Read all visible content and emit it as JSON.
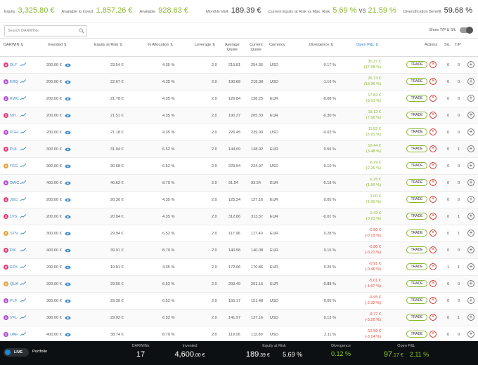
{
  "topbar": {
    "equity_label": "Equity",
    "equity_value": "3,325.80 €",
    "available_invest_label": "Available to invest",
    "available_invest_value": "1,857.26 €",
    "available_label": "Available",
    "available_value": "928.63 €",
    "monthly_var_label": "Monthly VaR",
    "monthly_var_value": "189.39 €",
    "equity_risk_label": "Current Equity at Risk vs Max. Risk",
    "equity_risk_current": "5.69 %",
    "equity_risk_sep": "vs",
    "equity_risk_max": "21.59 %",
    "diversification_label": "Diversification Benefit",
    "diversification_value": "59.68 %"
  },
  "search": {
    "placeholder": "Search DARWINs"
  },
  "toggle": {
    "label": "Show T/P & S/L"
  },
  "headers": {
    "darwin": "DARWIN",
    "invested": "Invested",
    "equity_risk": "Equity at Risk",
    "allocation": "% Allocation",
    "leverage": "Leverage",
    "avg_quote_1": "Average",
    "avg_quote_2": "Quote",
    "cur_quote_1": "Current",
    "cur_quote_2": "Quote",
    "currency": "Currency",
    "divergence": "Divergence",
    "open_pnl": "Open P&L",
    "actions": "Actions",
    "sl": "S/L",
    "tp": "T/P",
    "sort_arrow": "⇅"
  },
  "row_labels": {
    "trade": "TRADE",
    "close": "×",
    "add": "+"
  },
  "rows": [
    {
      "id": "DLF",
      "color": "#e0407a",
      "invested": "200.00 €",
      "risk": "23.54 €",
      "alloc": "4.35 %",
      "lev": "2.0",
      "avg": "215.81",
      "cur": "254.36",
      "ccy": "USD",
      "div": "-0.17 %",
      "pnl": "35.37 €",
      "pnlp": "(17.68 %)",
      "pos": true,
      "sl": "0",
      "tp": "0"
    },
    {
      "id": "ERQ",
      "color": "#b04fd0",
      "invested": "200.00 €",
      "risk": "22.67 €",
      "alloc": "4.35 %",
      "lev": "2.0",
      "avg": "190.68",
      "cur": "218.38",
      "ccy": "USD",
      "div": "-1.16 %",
      "pnl": "26.73 €",
      "pnlp": "(13.36 %)",
      "pos": true,
      "sl": "0",
      "tp": "0"
    },
    {
      "id": "KWC",
      "color": "#b04fd0",
      "invested": "200.00 €",
      "risk": "21.78 €",
      "alloc": "4.35 %",
      "lev": "2.0",
      "avg": "126.84",
      "cur": "138.25",
      "ccy": "EUR",
      "div": "-0.08 %",
      "pnl": "17.82 €",
      "pnlp": "(8.91 %)",
      "pos": true,
      "sl": "0",
      "tp": "0"
    },
    {
      "id": "NTI",
      "color": "#e0407a",
      "invested": "200.00 €",
      "risk": "21.51 €",
      "alloc": "4.35 %",
      "lev": "2.0",
      "avg": "190.37",
      "cur": "205.33",
      "ccy": "EUR",
      "div": "-0.30 %",
      "pnl": "15.12 €",
      "pnlp": "(7.56 %)",
      "pos": true,
      "sl": "0",
      "tp": "0"
    },
    {
      "id": "PGH",
      "color": "#b04fd0",
      "invested": "200.00 €",
      "risk": "21.18 €",
      "alloc": "4.35 %",
      "lev": "2.0",
      "avg": "226.45",
      "cur": "239.90",
      "ccy": "USD",
      "div": "-0.03 %",
      "pnl": "11.82 €",
      "pnlp": "(5.91 %)",
      "pos": true,
      "sl": "0",
      "tp": "0"
    },
    {
      "id": "PUL",
      "color": "#e0407a",
      "invested": "300.00 €",
      "risk": "31.04 €",
      "alloc": "6.52 %",
      "lev": "2.0",
      "avg": "144.69",
      "cur": "148.92",
      "ccy": "EUR",
      "div": "0.56 %",
      "pnl": "10.44 €",
      "pnlp": "(3.48 %)",
      "pos": true,
      "sl": "0",
      "tp": "1"
    },
    {
      "id": "FEG",
      "color": "#e8a43a",
      "invested": "300.00 €",
      "risk": "30.68 €",
      "alloc": "6.52 %",
      "lev": "2.0",
      "avg": "229.54",
      "cur": "234.97",
      "ccy": "USD",
      "div": "-0.10 %",
      "pnl": "6.79 €",
      "pnlp": "(2.26 %)",
      "pos": true,
      "sl": "0",
      "tp": "0"
    },
    {
      "id": "DWC",
      "color": "#b04fd0",
      "invested": "400.00 €",
      "risk": "40.62 €",
      "alloc": "8.70 %",
      "lev": "2.0",
      "avg": "91.94",
      "cur": "93.54",
      "ccy": "EUR",
      "div": "-0.18 %",
      "pnl": "6.25 €",
      "pnlp": "(1.56 %)",
      "pos": true,
      "sl": "0",
      "tp": "0"
    },
    {
      "id": "JGC",
      "color": "#e0407a",
      "invested": "200.00 €",
      "risk": "20.30 €",
      "alloc": "4.35 %",
      "lev": "2.0",
      "avg": "125.34",
      "cur": "127.16",
      "ccy": "EUR",
      "div": "0.05 %",
      "pnl": "3.00 €",
      "pnlp": "(1.50 %)",
      "pos": true,
      "sl": "0",
      "tp": "0"
    },
    {
      "id": "LVS",
      "color": "#e0407a",
      "invested": "200.00 €",
      "risk": "20.04 €",
      "alloc": "4.35 %",
      "lev": "2.0",
      "avg": "312.86",
      "cur": "313.57",
      "ccy": "EUR",
      "div": "-0.01 %",
      "pnl": "0.43 €",
      "pnlp": "(0.21 %)",
      "pos": true,
      "sl": "0",
      "tp": "1"
    },
    {
      "id": "STN",
      "color": "#e8a43a",
      "invested": "300.00 €",
      "risk": "29.94 €",
      "alloc": "6.52 %",
      "lev": "2.0",
      "avg": "117.96",
      "cur": "117.40",
      "ccy": "EUR",
      "div": "0.28 %",
      "pnl": "-0.56 €",
      "pnlp": "(-0.19 %)",
      "pos": false,
      "sl": "0",
      "tp": "1"
    },
    {
      "id": "PIK",
      "color": "#e0407a",
      "invested": "400.00 €",
      "risk": "39.91 €",
      "alloc": "8.70 %",
      "lev": "2.0",
      "avg": "140.58",
      "cur": "140.08",
      "ccy": "EUR",
      "div": "0.15 %",
      "pnl": "-0.86 €",
      "pnlp": "(-0.21 %)",
      "pos": false,
      "sl": "0",
      "tp": "0"
    },
    {
      "id": "EZX",
      "color": "#e0407a",
      "invested": "200.00 €",
      "risk": "19.91 €",
      "alloc": "4.35 %",
      "lev": "2.0",
      "avg": "172.06",
      "cur": "170.86",
      "ccy": "EUR",
      "div": "0.25 %",
      "pnl": "-0.91 €",
      "pnlp": "(-0.46 %)",
      "pos": false,
      "sl": "1",
      "tp": "1"
    },
    {
      "id": "QUA",
      "color": "#e8a43a",
      "invested": "300.00 €",
      "risk": "29.50 €",
      "alloc": "6.52 %",
      "lev": "2.0",
      "avg": "293.49",
      "cur": "291.16",
      "ccy": "EUR",
      "div": "-0.88 %",
      "pnl": "-5.01 €",
      "pnlp": "(-1.67 %)",
      "pos": false,
      "sl": "0",
      "tp": "0"
    },
    {
      "id": "PLF",
      "color": "#b04fd0",
      "invested": "300.00 €",
      "risk": "29.30 €",
      "alloc": "6.52 %",
      "lev": "2.0",
      "avg": "155.17",
      "cur": "151.48",
      "ccy": "USD",
      "div": "0.05 %",
      "pnl": "-6.95 €",
      "pnlp": "(-2.32 %)",
      "pos": false,
      "sl": "0",
      "tp": "0"
    },
    {
      "id": "VFL",
      "color": "#b04fd0",
      "invested": "300.00 €",
      "risk": "29.02 €",
      "alloc": "6.52 %",
      "lev": "2.0",
      "avg": "141.97",
      "cur": "137.16",
      "ccy": "USD",
      "div": "0.13 %",
      "pnl": "-9.77 €",
      "pnlp": "(-3.26 %)",
      "pos": false,
      "sl": "0",
      "tp": "1"
    },
    {
      "id": "UAF",
      "color": "#b04fd0",
      "invested": "400.00 €",
      "risk": "38.74 €",
      "alloc": "8.70 %",
      "lev": "2.0",
      "avg": "119.06",
      "cur": "112.80",
      "ccy": "USD",
      "div": "2.11 %",
      "pnl": "-12.56 €",
      "pnlp": "(-3.14 %)",
      "pos": false,
      "sl": "0",
      "tp": "0"
    }
  ],
  "footer": {
    "live_label": "LIVE",
    "portfolio_label": "Portfolio",
    "darwins_label": "DARWINs",
    "darwins_value": "17",
    "invested_label": "Invested",
    "invested_value": "4,600",
    "invested_dec": ".00 €",
    "risk_label": "Equity at Risk",
    "risk_value": "189",
    "risk_dec": ".39 €",
    "risk_pct": "5.69 %",
    "div_label": "Divergence",
    "div_value": "0.12 %",
    "pnl_label": "Open P&L",
    "pnl_value": "97",
    "pnl_dec": ".17 €",
    "pnl_pct": "2.11 %"
  },
  "colors": {
    "green": "#8ab832",
    "red": "#e24a3b",
    "blue": "#2a7fc9"
  }
}
